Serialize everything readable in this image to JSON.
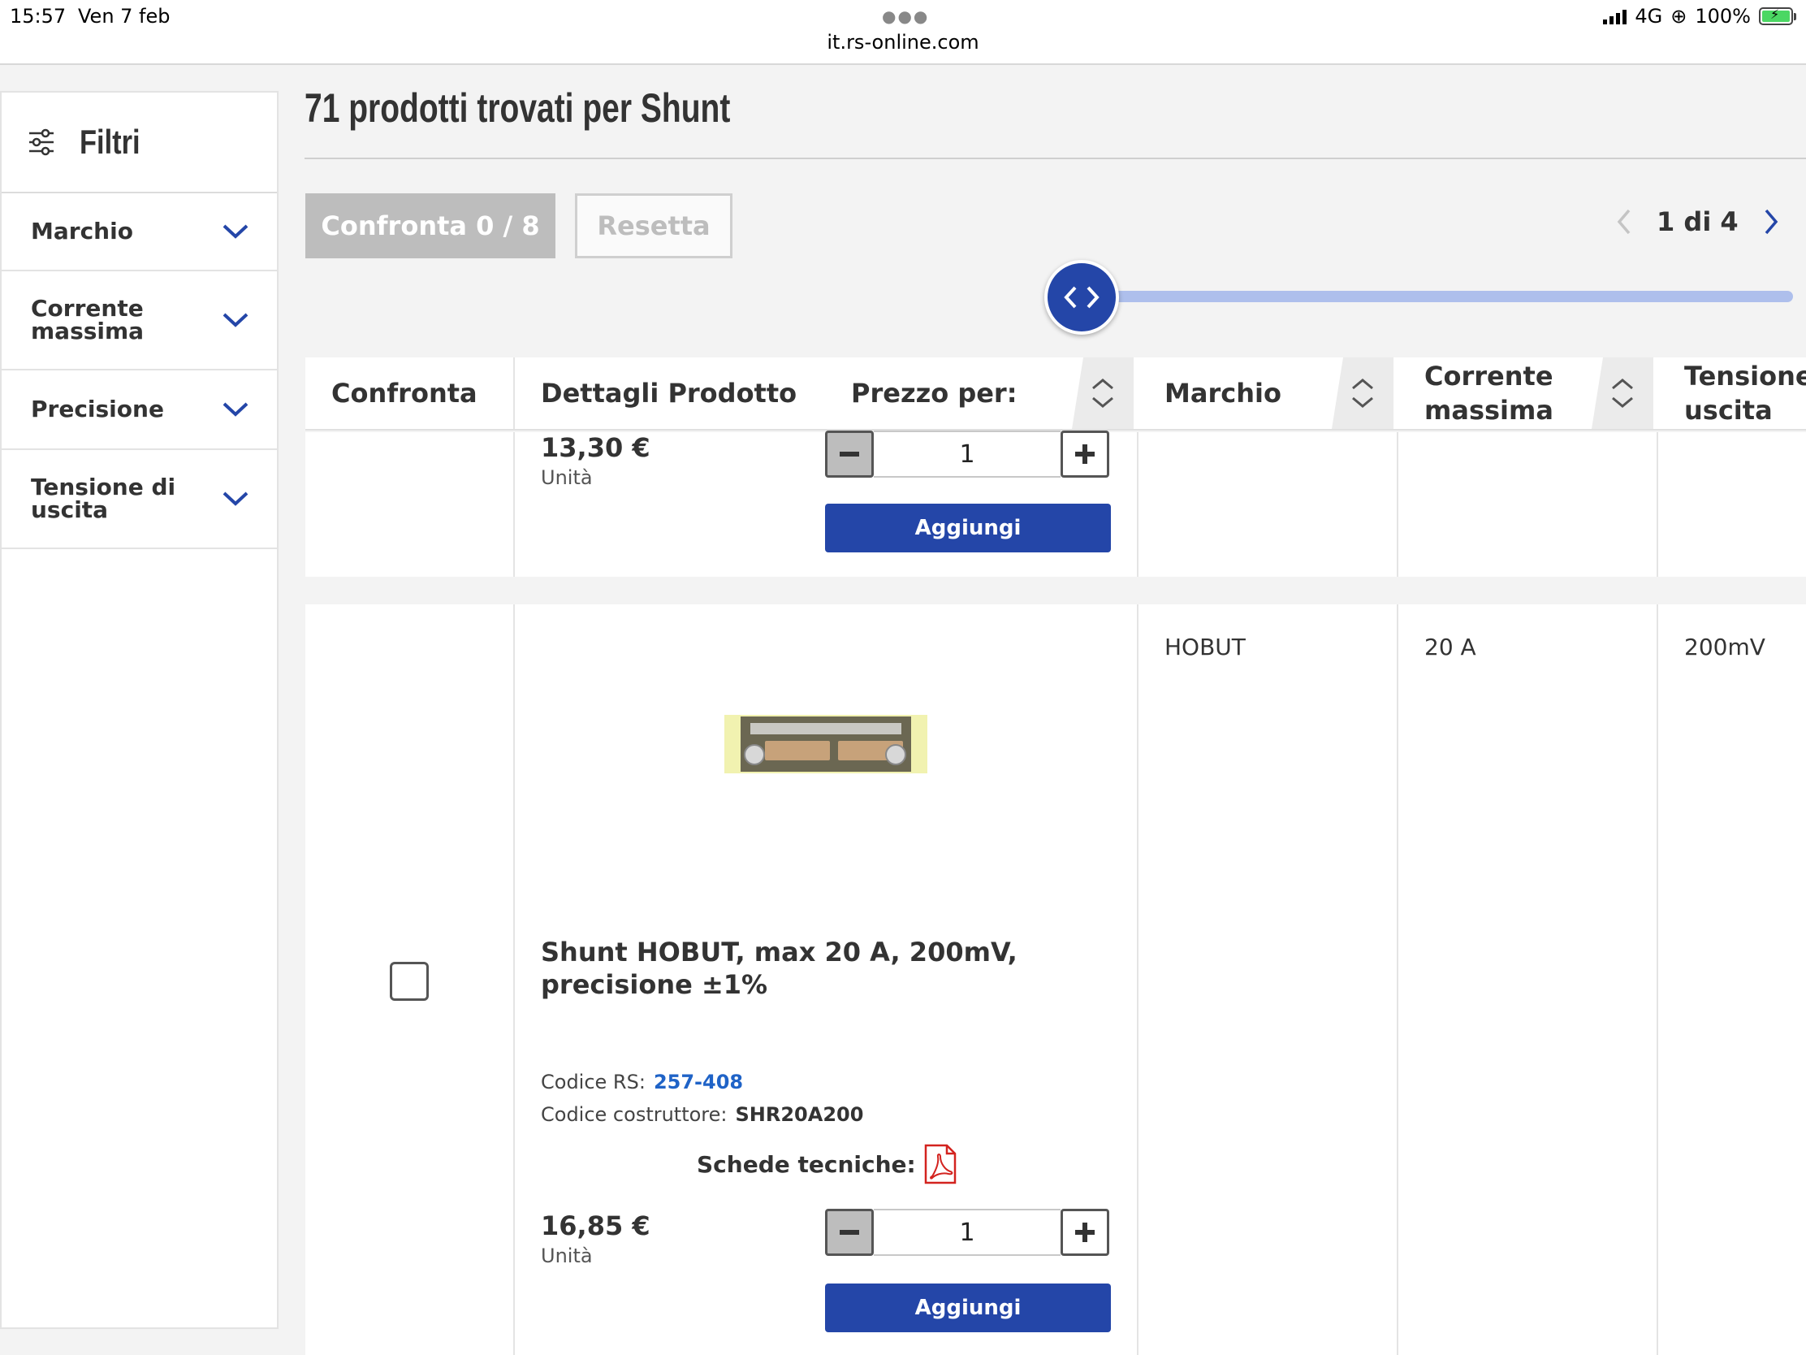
{
  "status_bar": {
    "time": "15:57",
    "date": "Ven 7 feb",
    "url": "it.rs-online.com",
    "network": "4G",
    "battery": "100%"
  },
  "sidebar": {
    "title": "Filtri",
    "items": [
      {
        "label": "Marchio"
      },
      {
        "label": "Corrente massima"
      },
      {
        "label": "Precisione"
      },
      {
        "label": "Tensione di uscita"
      }
    ]
  },
  "main": {
    "title": "71 prodotti trovati per Shunt",
    "compare_button": "Confronta 0 / 8",
    "reset_button": "Resetta",
    "pagination": "1 di 4"
  },
  "table": {
    "headers": {
      "compare": "Confronta",
      "details": "Dettagli Prodotto",
      "price": "Prezzo per:",
      "brand": "Marchio",
      "current": "Corrente massima",
      "voltage": "Tensione uscita"
    },
    "rows": [
      {
        "price": "13,30 €",
        "unit": "Unità",
        "quantity": "1",
        "add_label": "Aggiungi"
      },
      {
        "title": "Shunt HOBUT, max 20 A, 200mV, precisione ±1%",
        "rs_code_label": "Codice RS:",
        "rs_code": "257-408",
        "mfr_code_label": "Codice costruttore:",
        "mfr_code": "SHR20A200",
        "datasheets_label": "Schede tecniche:",
        "price": "16,85 €",
        "unit": "Unità",
        "quantity": "1",
        "add_label": "Aggiungi",
        "brand": "HOBUT",
        "current": "20 A",
        "voltage": "200mV"
      }
    ]
  },
  "colors": {
    "accent": "#2446a8",
    "link": "#1f63c7",
    "slider_track": "#aebfec",
    "disabled": "#bdbdbd"
  }
}
